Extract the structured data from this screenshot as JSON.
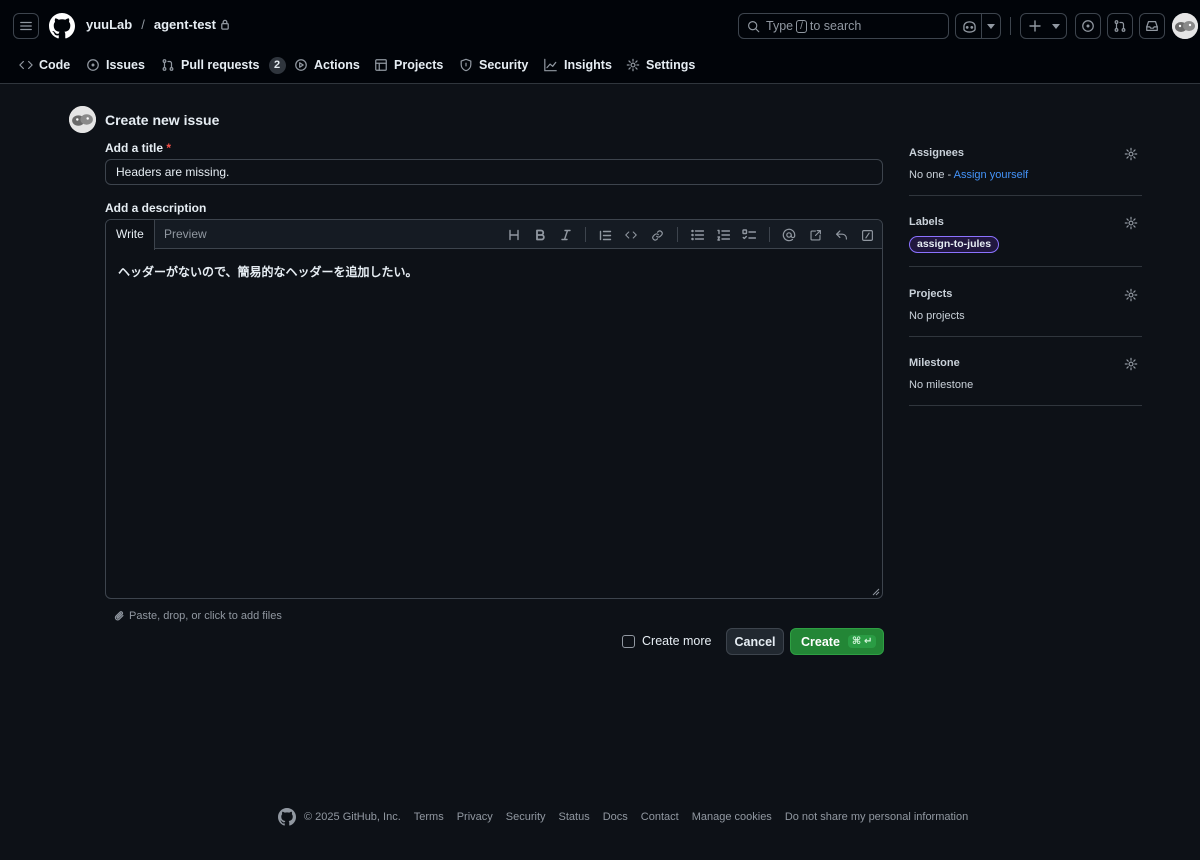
{
  "header": {
    "owner": "yuuLab",
    "separator": "/",
    "repo": "agent-test",
    "search": {
      "prefix": "Type",
      "key": "/",
      "suffix": "to search"
    }
  },
  "nav": {
    "code": "Code",
    "issues": "Issues",
    "pull_requests": "Pull requests",
    "pull_requests_count": "2",
    "actions": "Actions",
    "projects": "Projects",
    "security": "Security",
    "insights": "Insights",
    "settings": "Settings"
  },
  "form": {
    "heading": "Create new issue",
    "title_label": "Add a title",
    "required_mark": "*",
    "title_value": "Headers are missing.",
    "description_label": "Add a description",
    "tab_write": "Write",
    "tab_preview": "Preview",
    "description_value": "ヘッダーがないので、簡易的なヘッダーを追加したい。",
    "attach_hint": "Paste, drop, or click to add files",
    "create_more": "Create more",
    "cancel": "Cancel",
    "create": "Create",
    "create_shortcut": "⌘ ↵"
  },
  "sidebar": {
    "assignees": {
      "title": "Assignees",
      "value_prefix": "No one - ",
      "link": "Assign yourself"
    },
    "labels": {
      "title": "Labels",
      "label": "assign-to-jules",
      "label_color": "#8b72ff"
    },
    "projects": {
      "title": "Projects",
      "value": "No projects"
    },
    "milestone": {
      "title": "Milestone",
      "value": "No milestone"
    }
  },
  "footer": {
    "copyright": "© 2025 GitHub, Inc.",
    "links": [
      "Terms",
      "Privacy",
      "Security",
      "Status",
      "Docs",
      "Contact",
      "Manage cookies",
      "Do not share my personal information"
    ]
  },
  "colors": {
    "background": "#0d1117",
    "header": "#010409",
    "primary_button": "#238636",
    "link": "#4493f8"
  }
}
